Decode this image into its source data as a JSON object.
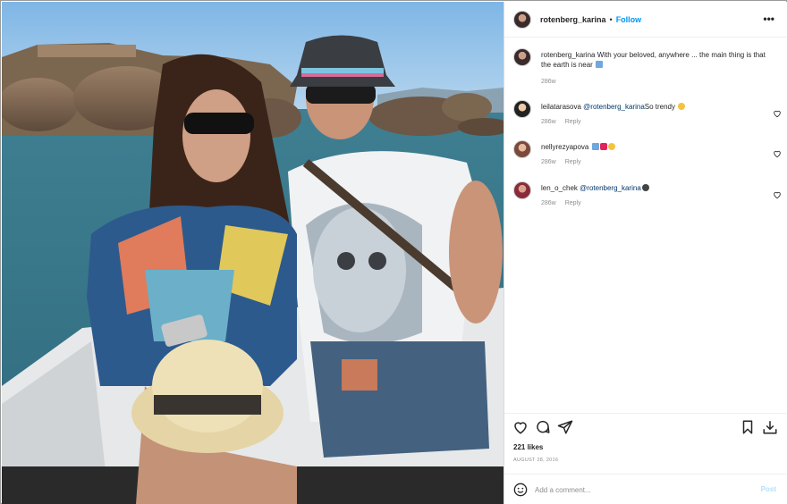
{
  "post": {
    "username": "rotenberg_karina",
    "separator": "•",
    "follow_label": "Follow",
    "more_icon": "•••"
  },
  "caption": {
    "username": "rotenberg_karina",
    "text": "With your beloved, anywhere ... the main thing is that the earth is near",
    "age": "286w"
  },
  "comments": [
    {
      "username": "leilatarasova",
      "mention": "@rotenberg_karina",
      "text": "So trendy",
      "age": "286w",
      "reply_label": "Reply"
    },
    {
      "username": "nellyrezyapova",
      "mention": "",
      "text": "",
      "age": "286w",
      "reply_label": "Reply"
    },
    {
      "username": "len_o_chek",
      "mention": "@rotenberg_karina",
      "text": "",
      "age": "286w",
      "reply_label": "Reply"
    }
  ],
  "footer": {
    "likes": "221 likes",
    "date": "AUGUST 28, 2016",
    "comment_placeholder": "Add a comment...",
    "post_label": "Post"
  },
  "colors": {
    "link_blue": "#0095f6",
    "post_disabled": "#b2dffc",
    "muted": "#8e8e8e"
  },
  "icons": [
    "heart-icon",
    "comment-icon",
    "share-icon",
    "bookmark-icon",
    "download-icon",
    "emoji-icon",
    "more-icon"
  ]
}
